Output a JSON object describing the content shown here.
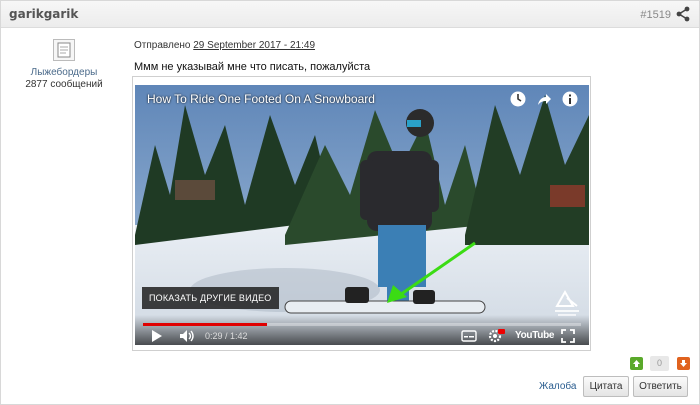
{
  "post": {
    "author": "garikgarik",
    "number": "#1519",
    "posted_label": "Отправлено",
    "posted_date": "29 September 2017 - 21:49",
    "message": "Ммм не указывай мне что писать, пожалуйста"
  },
  "user": {
    "group": "Лыжебордеры",
    "posts": "2877 сообщений"
  },
  "video": {
    "title": "How To Ride One Footed On A Snowboard",
    "more_videos_label": "ПОКАЗАТЬ ДРУГИЕ ВИДЕО",
    "time": "0:29 / 1:42",
    "progress": 0.283,
    "brand": "YouTube",
    "progress_color": "#e00000"
  },
  "votes": {
    "count": "0"
  },
  "actions": {
    "complaint": "Жалоба",
    "quote": "Цитата",
    "reply": "Ответить"
  },
  "icons": [
    "share-icon",
    "avatar-placeholder-icon",
    "clock-icon",
    "share-arrow-icon",
    "info-icon",
    "play-icon",
    "volume-icon",
    "subtitles-icon",
    "settings-icon",
    "fullscreen-icon",
    "arrow-up-icon",
    "arrow-down-icon"
  ]
}
